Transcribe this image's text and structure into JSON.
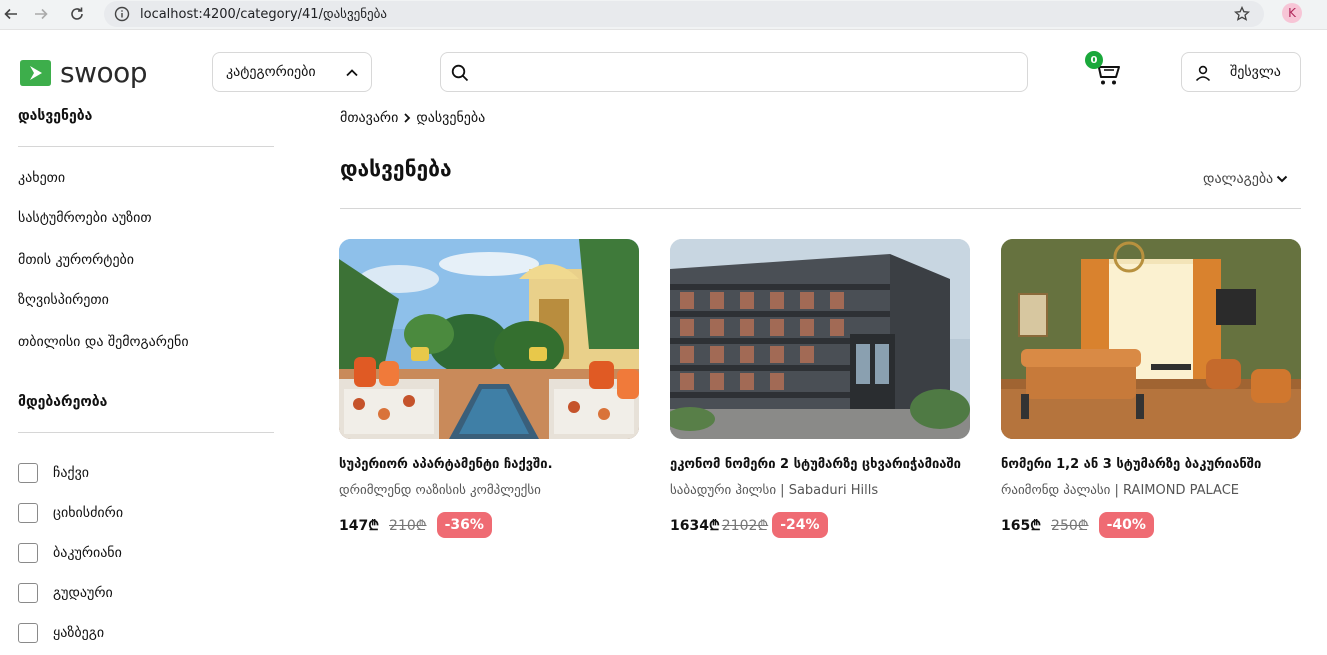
{
  "browser": {
    "url": "localhost:4200/category/41/დასვენება",
    "profile_initial": "K"
  },
  "header": {
    "logo_text": "swoop",
    "categories_label": "კატეგორიები",
    "search_placeholder": "",
    "cart_count": "0",
    "login_label": "შესვლა"
  },
  "sidebar": {
    "section1_title": "დასვენება",
    "items": [
      {
        "label": "კახეთი"
      },
      {
        "label": "სასტუმროები აუზით"
      },
      {
        "label": "მთის კურორტები"
      },
      {
        "label": "ზღვისპირეთი"
      },
      {
        "label": "თბილისი და შემოგარენი"
      }
    ],
    "section2_title": "მდებარეობა",
    "locations": [
      {
        "label": "ჩაქვი",
        "checked": false
      },
      {
        "label": "ციხისძირი",
        "checked": false
      },
      {
        "label": "ბაკურიანი",
        "checked": false
      },
      {
        "label": "გუდაური",
        "checked": false
      },
      {
        "label": "ყაზბეგი",
        "checked": false
      }
    ]
  },
  "main": {
    "breadcrumb": {
      "home": "მთავარი",
      "current": "დასვენება"
    },
    "title": "დასვენება",
    "sort_label": "დალაგება",
    "cards": [
      {
        "title": "სუპერიორ აპარტამენტი ჩაქვში.",
        "subtitle": "დრიმლენდ ოაზისის კომპლექსი",
        "price": "147₾",
        "old_price": "210₾",
        "discount": "-36%"
      },
      {
        "title": "ეკონომ ნომერი 2 სტუმარზე ცხვარიჭამიაში",
        "subtitle": "საბადური ჰილსი | Sabaduri Hills",
        "price": "1634₾",
        "old_price": "2102₾",
        "discount": "-24%"
      },
      {
        "title": "ნომერი 1,2 ან 3 სტუმარზე ბაკურიანში",
        "subtitle": "რაიმონდ პალასი | RAIMOND PALACE",
        "price": "165₾",
        "old_price": "250₾",
        "discount": "-40%"
      }
    ]
  },
  "colors": {
    "brand_green": "#3dae4b",
    "discount_red": "#ef6b73",
    "cart_badge": "#1aa83b"
  }
}
